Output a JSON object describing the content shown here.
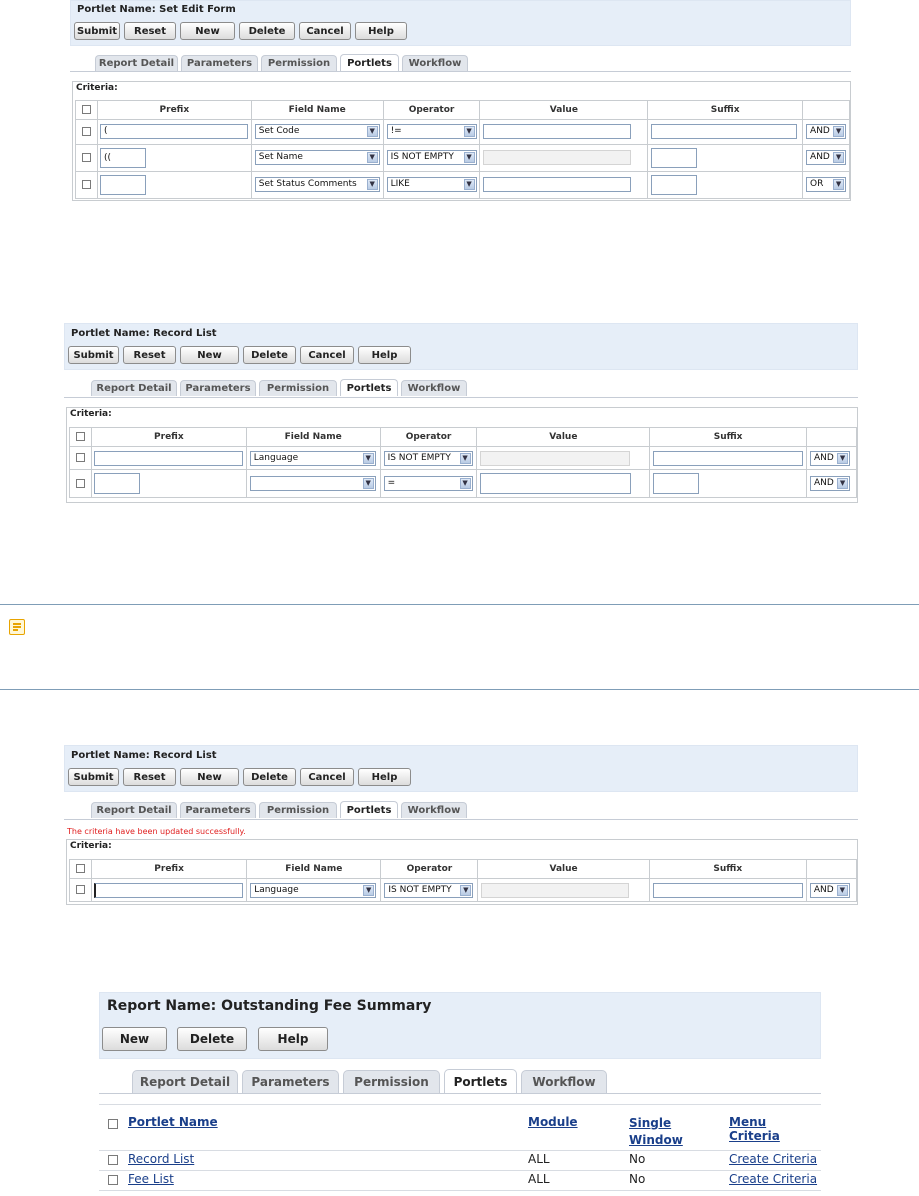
{
  "buttons": {
    "submit": "Submit",
    "reset": "Reset",
    "new": "New",
    "delete": "Delete",
    "cancel": "Cancel",
    "help": "Help"
  },
  "tabs": {
    "report_detail": "Report Detail",
    "parameters": "Parameters",
    "permission": "Permission",
    "portlets": "Portlets",
    "workflow": "Workflow"
  },
  "columns": {
    "prefix": "Prefix",
    "field_name": "Field Name",
    "operator": "Operator",
    "value": "Value",
    "suffix": "Suffix"
  },
  "criteria_label": "Criteria:",
  "panel1": {
    "portlet_name": "Portlet Name: Set Edit Form",
    "rows": [
      {
        "prefix": "(",
        "field": "Set Code",
        "operator": "!=",
        "value": "",
        "suffix": "",
        "logic": "AND"
      },
      {
        "prefix": "((",
        "field": "Set Name",
        "operator": "IS NOT EMPTY",
        "value": "",
        "suffix": "",
        "logic": "AND"
      },
      {
        "prefix": "",
        "field": "Set Status Comments",
        "operator": "LIKE",
        "value": "",
        "suffix": "",
        "logic": "OR"
      }
    ]
  },
  "panel2": {
    "portlet_name": "Portlet Name: Record List",
    "rows": [
      {
        "prefix": "",
        "field": "Language",
        "operator": "IS NOT EMPTY",
        "value": "",
        "suffix": "",
        "logic": "AND"
      },
      {
        "prefix": "",
        "field": "",
        "operator": "=",
        "value": "",
        "suffix": "",
        "logic": "AND"
      }
    ]
  },
  "panel3": {
    "portlet_name": "Portlet Name: Record List",
    "success": "The criteria have been updated successfully.",
    "rows": [
      {
        "prefix": "",
        "field": "Language",
        "operator": "IS NOT EMPTY",
        "value": "",
        "suffix": "",
        "logic": "AND"
      }
    ]
  },
  "panel4": {
    "report_name": "Report Name: Outstanding Fee Summary",
    "columns": {
      "portlet_name": "Portlet Name",
      "module": "Module",
      "single_window": "Single Window",
      "menu_criteria": "Menu Criteria"
    },
    "rows": [
      {
        "name": "Record List",
        "module": "ALL",
        "single": "No",
        "criteria": "Create Criteria"
      },
      {
        "name": "Fee List",
        "module": "ALL",
        "single": "No",
        "criteria": "Create Criteria"
      }
    ]
  },
  "icons": {
    "note": "note-icon",
    "dropdown": "chevron-down-icon"
  }
}
